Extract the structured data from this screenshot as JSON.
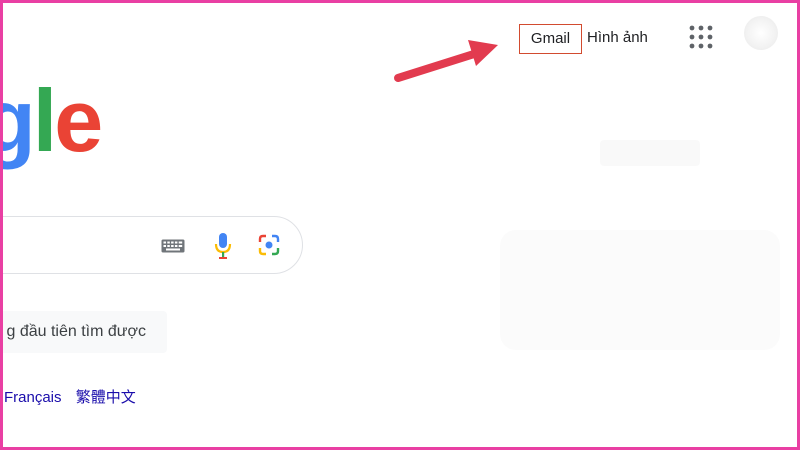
{
  "header": {
    "gmail_label": "Gmail",
    "images_label": "Hình ảnh",
    "apps_icon": "apps-grid-icon",
    "avatar": "account-avatar"
  },
  "logo": {
    "g": "g",
    "l": "l",
    "e": "e"
  },
  "search": {
    "keyboard_icon": "keyboard-icon",
    "mic_icon": "microphone-icon",
    "lens_icon": "google-lens-icon"
  },
  "buttons": {
    "lucky_label": "g đầu tiên tìm được"
  },
  "languages": [
    "Français",
    "繁體中文"
  ],
  "colors": {
    "frame": "#e93fa3",
    "highlight_box": "#d24b2f",
    "arrow": "#e23b4f",
    "google_blue": "#4285f4",
    "google_green": "#34a853",
    "google_red": "#ea4335",
    "google_yellow": "#fbbc05"
  }
}
